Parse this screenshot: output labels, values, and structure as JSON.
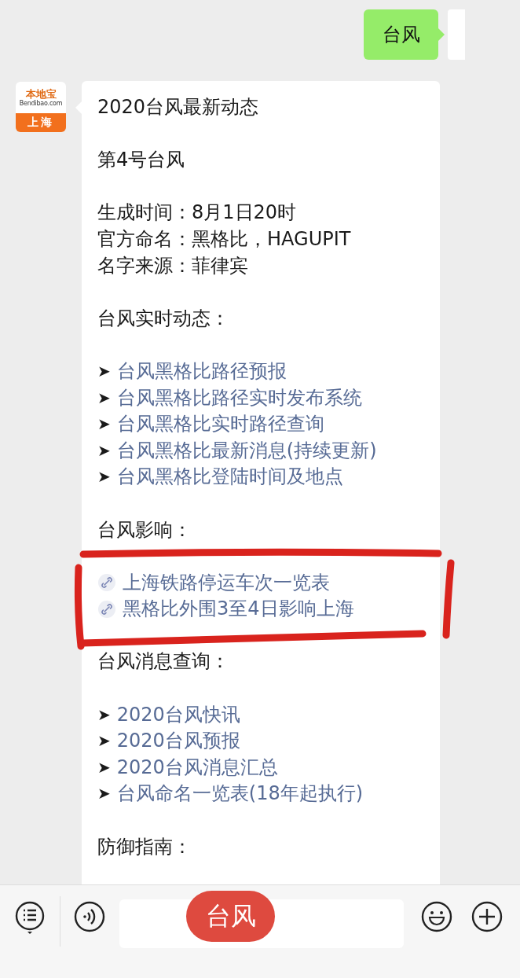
{
  "sent": {
    "text": "台风"
  },
  "bot_avatar": {
    "brand": "本地宝",
    "site": "Bendibao.com",
    "city": "上海"
  },
  "message": {
    "blocks": [
      {
        "kind": "text",
        "lines": [
          "2020台风最新动态"
        ]
      },
      {
        "kind": "text",
        "lines": [
          "第4号台风"
        ]
      },
      {
        "kind": "text",
        "lines": [
          "生成时间：8月1日20时",
          "官方命名：黑格比，HAGUPIT",
          "名字来源：菲律宾"
        ]
      },
      {
        "kind": "text",
        "lines": [
          "台风实时动态："
        ]
      },
      {
        "kind": "arrow_links",
        "items": [
          {
            "bullet": "➤",
            "text": "台风黑格比路径预报"
          },
          {
            "bullet": "➤",
            "text": "台风黑格比路径实时发布系统"
          },
          {
            "bullet": "➤",
            "text": "台风黑格比实时路径查询"
          },
          {
            "bullet": "➤",
            "text": "台风黑格比最新消息(持续更新)"
          },
          {
            "bullet": "➤",
            "text": "台风黑格比登陆时间及地点"
          }
        ]
      },
      {
        "kind": "text",
        "lines": [
          "台风影响："
        ]
      },
      {
        "kind": "chain_links",
        "items": [
          {
            "text": "上海铁路停运车次一览表"
          },
          {
            "text": "黑格比外围3至4日影响上海"
          }
        ]
      },
      {
        "kind": "text",
        "lines": [
          "台风消息查询："
        ]
      },
      {
        "kind": "arrow_links",
        "items": [
          {
            "bullet": "➤",
            "text": "2020台风快讯"
          },
          {
            "bullet": "➤",
            "text": "2020台风预报"
          },
          {
            "bullet": "➤",
            "text": "2020台风消息汇总"
          },
          {
            "bullet": "➤",
            "text": "台风命名一览表(18年起执行)"
          }
        ]
      },
      {
        "kind": "text",
        "lines": [
          "防御指南："
        ]
      }
    ]
  },
  "overlay_label": "台风"
}
